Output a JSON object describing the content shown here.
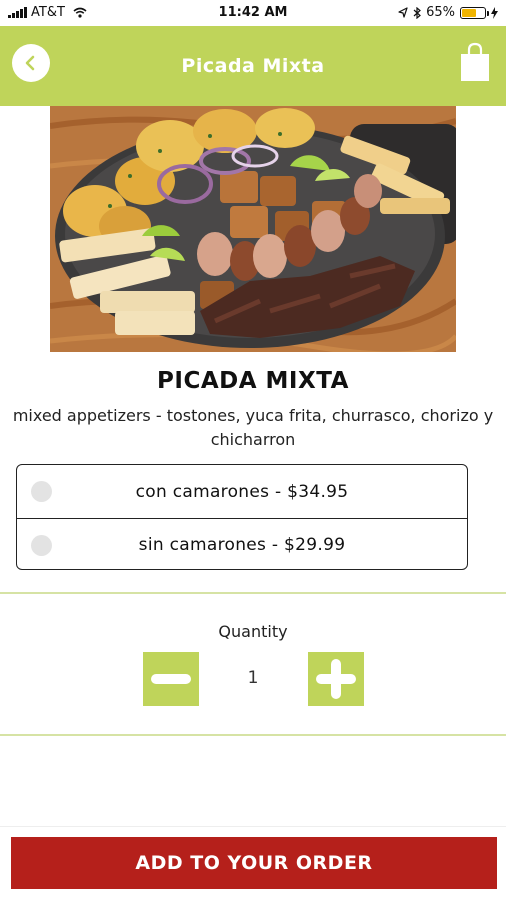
{
  "status_bar": {
    "carrier": "AT&T",
    "time": "11:42 AM",
    "battery": "65%",
    "battery_level": 0.65
  },
  "header": {
    "title": "Picada Mixta",
    "back_icon": "chevron-left-icon",
    "cart_icon": "shopping-bag-icon"
  },
  "item": {
    "name": "PICADA MIXTA",
    "description": "mixed appetizers - tostones, yuca frita, churrasco, chorizo y chicharron"
  },
  "options": [
    {
      "label": "con camarones - $34.95",
      "selected": false
    },
    {
      "label": "sin camarones - $29.99",
      "selected": false
    }
  ],
  "quantity": {
    "label": "Quantity",
    "value": "1"
  },
  "add_button": {
    "label": "ADD TO YOUR ORDER"
  },
  "colors": {
    "accent": "#bfd45a",
    "cta": "#b5201b"
  }
}
